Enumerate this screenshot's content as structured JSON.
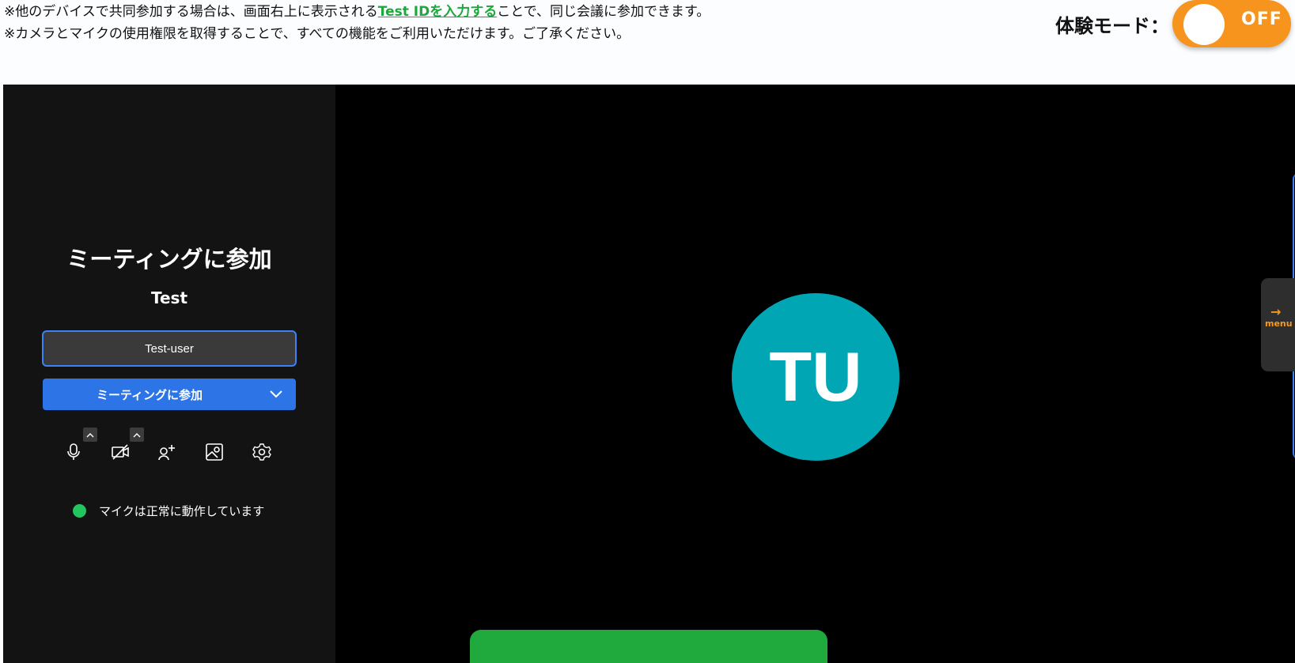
{
  "notice": {
    "line1_prefix": "※他のデバイスで共同参加する場合は、画面右上に表示される",
    "line1_link": "Test IDを入力する",
    "line1_suffix": "ことで、同じ会議に参加できます。",
    "line2": "※カメラとマイクの使用権限を取得することで、すべての機能をご利用いただけます。ご了承ください。"
  },
  "trial_mode": {
    "label": "体験モード：",
    "toggle_state": "OFF"
  },
  "join_panel": {
    "title": "ミーティングに参加",
    "meeting_name": "Test",
    "name_input_value": "Test-user",
    "join_button_label": "ミーティングに参加",
    "controls": [
      "microphone-icon",
      "camera-off-icon",
      "invite-icon",
      "background-icon",
      "settings-icon"
    ],
    "status_text": "マイクは正常に動作しています",
    "status_color": "#22c55e"
  },
  "video": {
    "avatar_initials": "TU",
    "avatar_color": "#00a6b4"
  },
  "side_menu": {
    "arrow": "→",
    "label": "menu"
  },
  "colors": {
    "accent_blue": "#2d74e7",
    "toggle_orange": "#f7941d",
    "link_green": "#1ea83c"
  }
}
